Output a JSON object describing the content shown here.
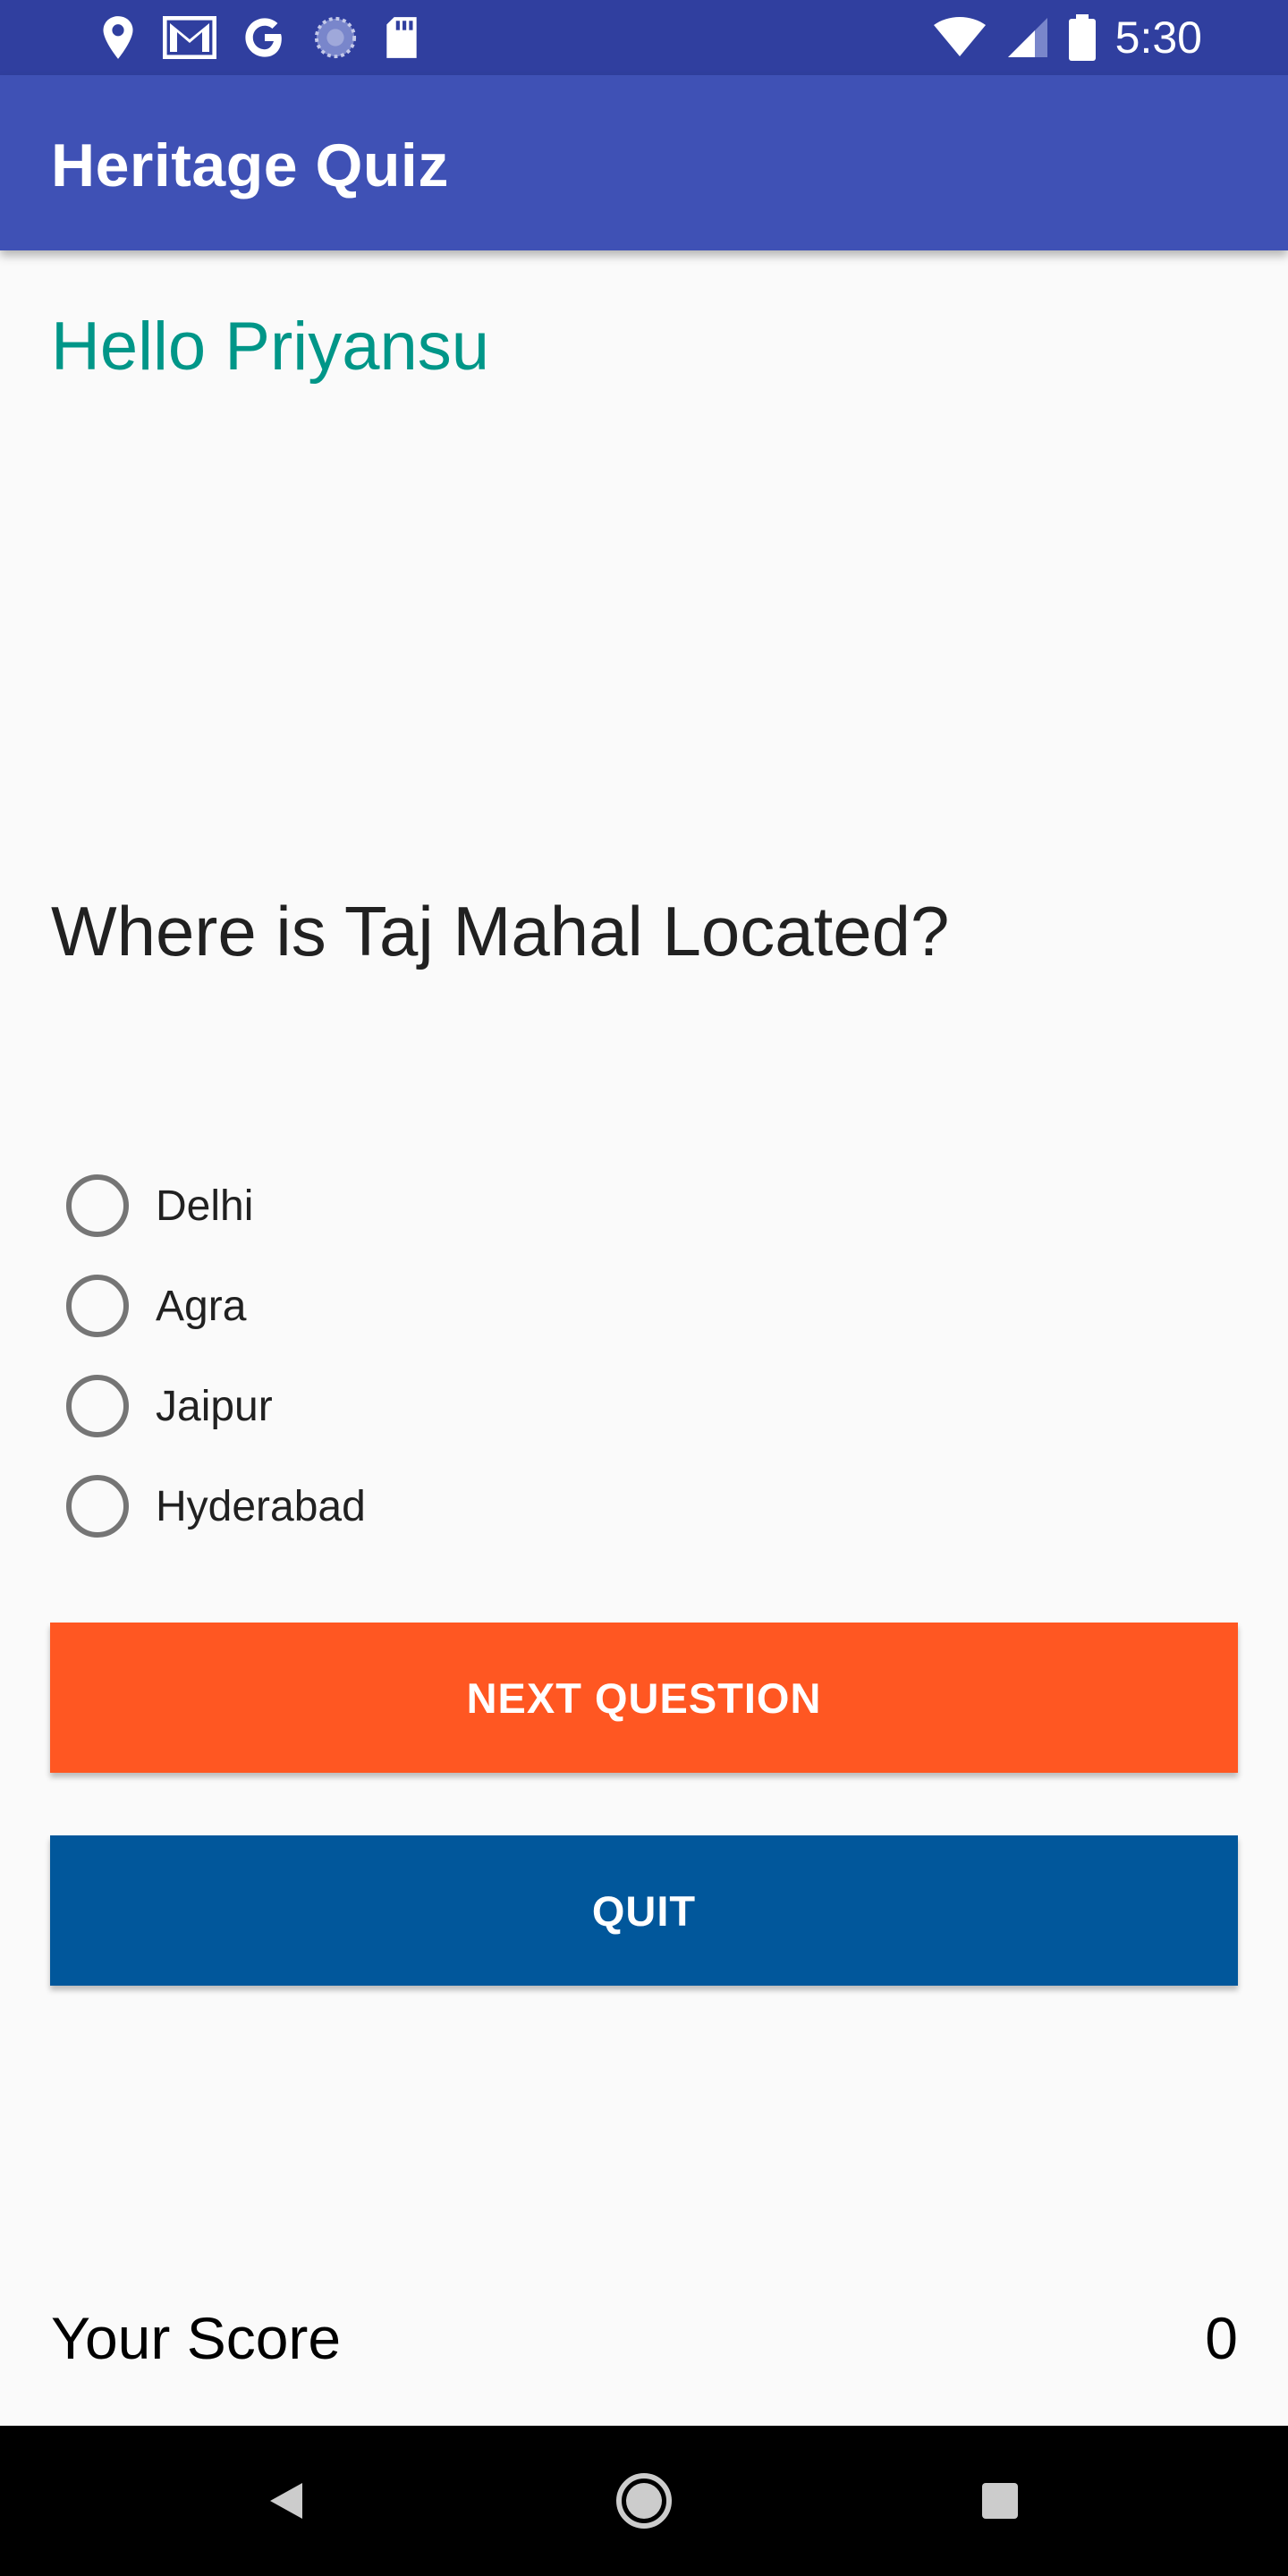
{
  "status_bar": {
    "time": "5:30",
    "left_icons": [
      "location-icon",
      "gmail-icon",
      "google-icon",
      "sync-icon",
      "sd-card-icon"
    ],
    "right_icons": [
      "wifi-icon",
      "signal-icon",
      "battery-icon"
    ]
  },
  "app_bar": {
    "title": "Heritage Quiz",
    "color": "#3f51b5"
  },
  "greeting": "Hello Priyansu",
  "question": "Where is Taj Mahal Located?",
  "options": [
    {
      "label": "Delhi",
      "selected": false
    },
    {
      "label": "Agra",
      "selected": false
    },
    {
      "label": "Jaipur",
      "selected": false
    },
    {
      "label": "Hyderabad",
      "selected": false
    }
  ],
  "buttons": {
    "next": {
      "label": "NEXT QUESTION",
      "color": "#ff5722"
    },
    "quit": {
      "label": "QUIT",
      "color": "#01579b"
    }
  },
  "score": {
    "label": "Your Score",
    "value": "0"
  },
  "nav_bar": {
    "buttons": [
      "back-icon",
      "home-icon",
      "recents-icon"
    ]
  }
}
